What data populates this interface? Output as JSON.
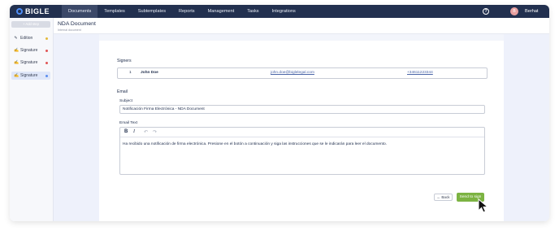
{
  "app": {
    "logo_text": "BIGLE"
  },
  "nav": {
    "items": [
      {
        "label": "Documents",
        "active": true
      },
      {
        "label": "Templates",
        "active": false
      },
      {
        "label": "Subtemplates",
        "active": false
      },
      {
        "label": "Reports",
        "active": false
      },
      {
        "label": "Management",
        "active": false
      },
      {
        "label": "Tasks",
        "active": false
      },
      {
        "label": "Integrations",
        "active": false
      }
    ],
    "help_label": "?",
    "avatar_initial": "B",
    "user_name": "Berhat"
  },
  "sidebar": {
    "add_step_label": "+ Add step",
    "items": [
      {
        "label": "Edition",
        "icon": "edit-icon",
        "status_color": "#e3b93a"
      },
      {
        "label": "Signature",
        "icon": "signature-icon",
        "status_color": "#e05555"
      },
      {
        "label": "Signature",
        "icon": "signature-icon",
        "status_color": "#e05555"
      },
      {
        "label": "Signature",
        "icon": "signature-icon",
        "status_color": "#5b8def",
        "active": true
      }
    ]
  },
  "header": {
    "title": "NDA Document",
    "subtitle": "Internal document"
  },
  "signers": {
    "label": "Signers",
    "rows": [
      {
        "index": "1",
        "name": "John Doe",
        "email": "john.doe@biglelegal.com",
        "phone": "+34611223344"
      }
    ]
  },
  "email": {
    "section_label": "Email",
    "subject_label": "Subject",
    "subject_value": "Notificación Firma Electrónica - NDA Document",
    "text_label": "Email Text",
    "body": "Ha recibido una notificación de firma electrónica. Presione en el botón a continuación y siga las instrucciones que se le indicarán para leer el documento.",
    "toolbar": {
      "bold": "B",
      "italic": "I",
      "undo": "↶",
      "redo": "↷"
    }
  },
  "actions": {
    "back_label": "← Back",
    "send_label": "Send to sign"
  },
  "colors": {
    "topbar": "#22304f",
    "accent": "#7cb342",
    "link": "#4b66a8"
  }
}
